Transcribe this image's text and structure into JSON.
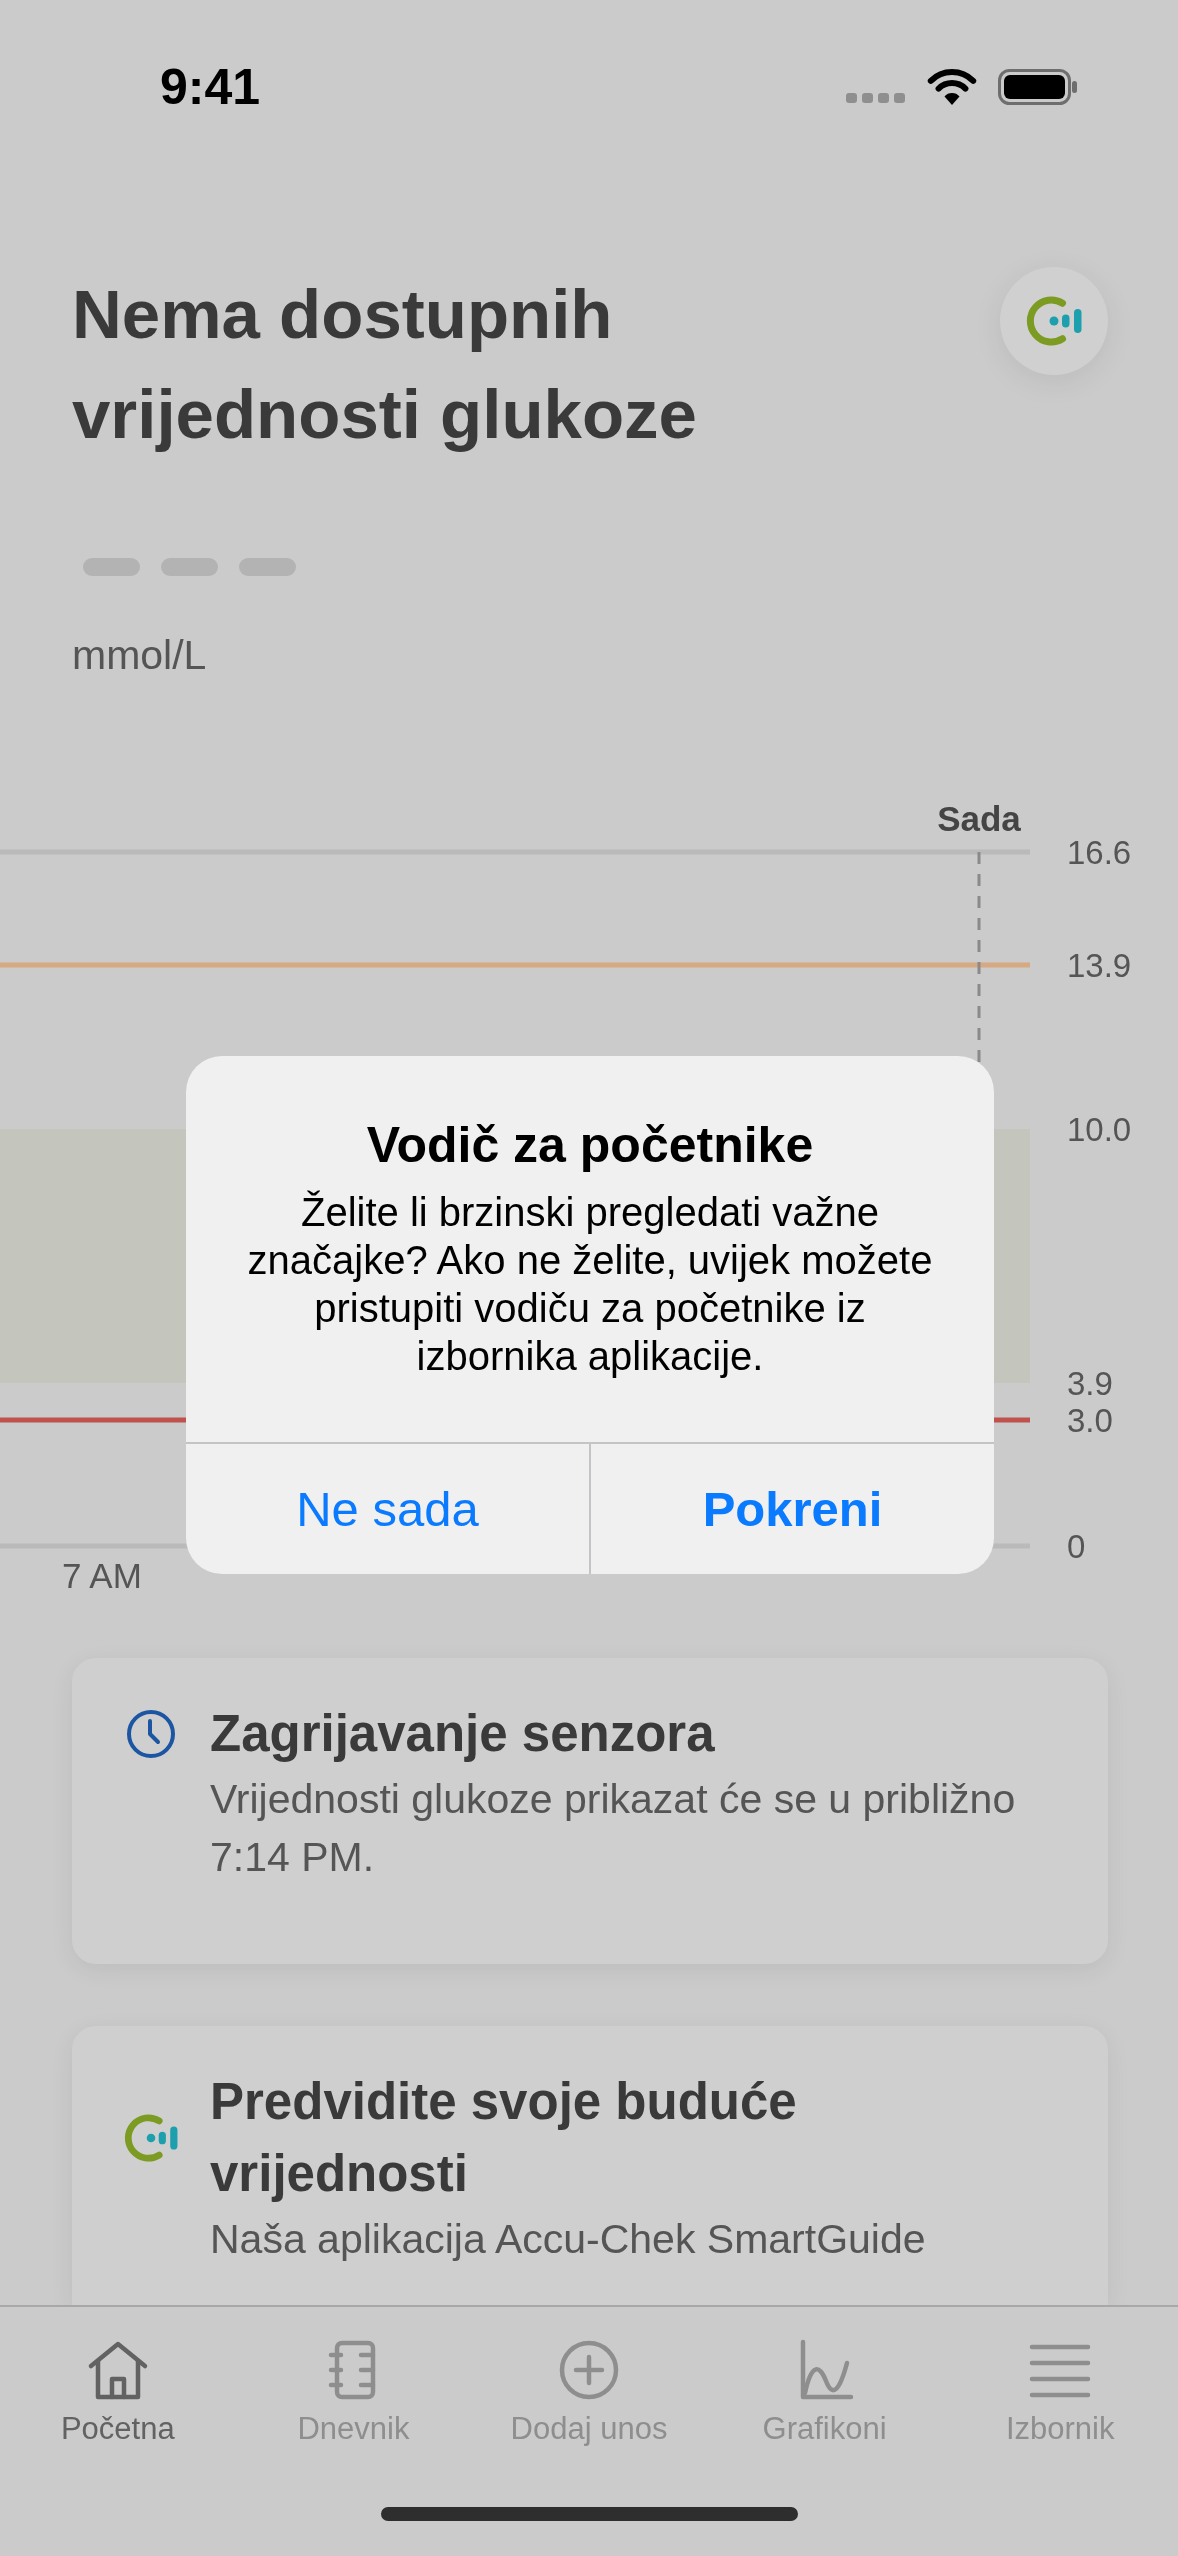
{
  "status_bar": {
    "time": "9:41"
  },
  "header": {
    "title": "Nema dostupnih vrijednosti glukoze",
    "unit": "mmol/L"
  },
  "chart": {
    "now_label": "Sada",
    "y_axis_labels": [
      "16.6",
      "13.9",
      "10.0",
      "3.9",
      "3.0",
      "0"
    ],
    "x_axis_labels": [
      "7 AM"
    ]
  },
  "dialog": {
    "title": "Vodič za početnike",
    "message": "Želite li brzinski pregledati važne značajke? Ako ne želite, uvijek možete pristupiti vodiču za početnike iz izbornika aplikacije.",
    "buttons": [
      {
        "label": "Ne sada",
        "preferred": false
      },
      {
        "label": "Pokreni",
        "preferred": true
      }
    ]
  },
  "cards": [
    {
      "kind": "notice",
      "title": "Zagrijavanje senzora",
      "text": "Vrijednosti glukoze prikazat će se u približno 7:14 PM."
    },
    {
      "kind": "feature",
      "title": "Predvidite svoje buduće vrijednosti",
      "text": "Naša aplikacija Accu-Chek SmartGuide"
    }
  ],
  "tab_bar": {
    "tabs": [
      {
        "kind": "home",
        "label": "Početna",
        "selected": true
      },
      {
        "kind": "diary",
        "label": "Dnevnik",
        "selected": false
      },
      {
        "kind": "add",
        "label": "Dodaj unos",
        "selected": false
      },
      {
        "kind": "charts",
        "label": "Grafikoni",
        "selected": false
      },
      {
        "kind": "menu",
        "label": "Izbornik",
        "selected": false
      }
    ]
  }
}
